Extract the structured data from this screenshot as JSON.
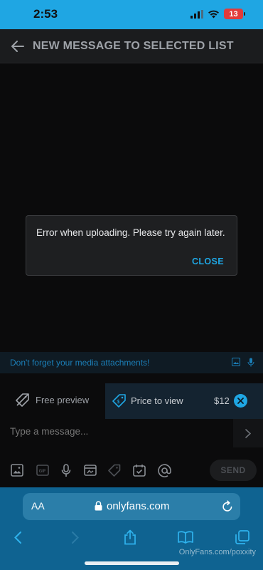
{
  "status": {
    "time": "2:53",
    "battery": "13"
  },
  "header": {
    "title": "NEW MESSAGE TO SELECTED LIST"
  },
  "dialog": {
    "message": "Error when uploading. Please try again later.",
    "close_label": "CLOSE"
  },
  "reminder": {
    "text": "Don't forget your media attachments!"
  },
  "pricing": {
    "free_preview_label": "Free preview",
    "price_label": "Price to view",
    "price_value": "$12"
  },
  "composer": {
    "placeholder": "Type a message...",
    "send_label": "SEND"
  },
  "browser": {
    "aa_label": "AA",
    "url": "onlyfans.com"
  },
  "watermark": "OnlyFans.com/poxxity",
  "colors": {
    "accent": "#1fa6e3",
    "status_bar": "#1fa6e3",
    "browser_bar": "#0f6391"
  }
}
